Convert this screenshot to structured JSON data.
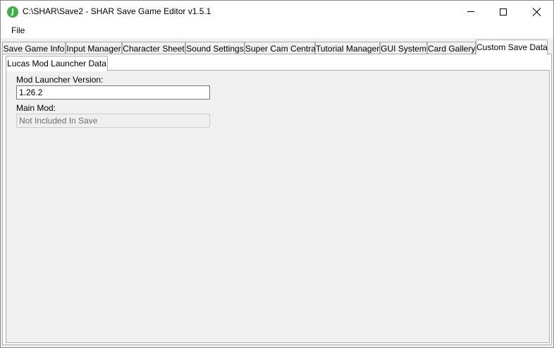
{
  "window": {
    "title": "C:\\SHAR\\Save2 - SHAR Save Game Editor v1.5.1",
    "icon_glyph": "J"
  },
  "menu": {
    "items": [
      {
        "label": "File"
      }
    ]
  },
  "tabs": [
    {
      "label": "Save Game Info",
      "active": false
    },
    {
      "label": "Input Manager",
      "active": false
    },
    {
      "label": "Character Sheet",
      "active": false
    },
    {
      "label": "Sound Settings",
      "active": false
    },
    {
      "label": "Super Cam Central",
      "active": false
    },
    {
      "label": "Tutorial Manager",
      "active": false
    },
    {
      "label": "GUI System",
      "active": false
    },
    {
      "label": "Card Gallery",
      "active": false
    },
    {
      "label": "Custom Save Data",
      "active": true
    }
  ],
  "inner_tabs": [
    {
      "label": "Lucas Mod Launcher Data",
      "active": true
    }
  ],
  "form": {
    "mod_launcher_version_label": "Mod Launcher Version:",
    "mod_launcher_version_value": "1.26.2",
    "main_mod_label": "Main Mod:",
    "main_mod_value": "Not Included In Save"
  }
}
